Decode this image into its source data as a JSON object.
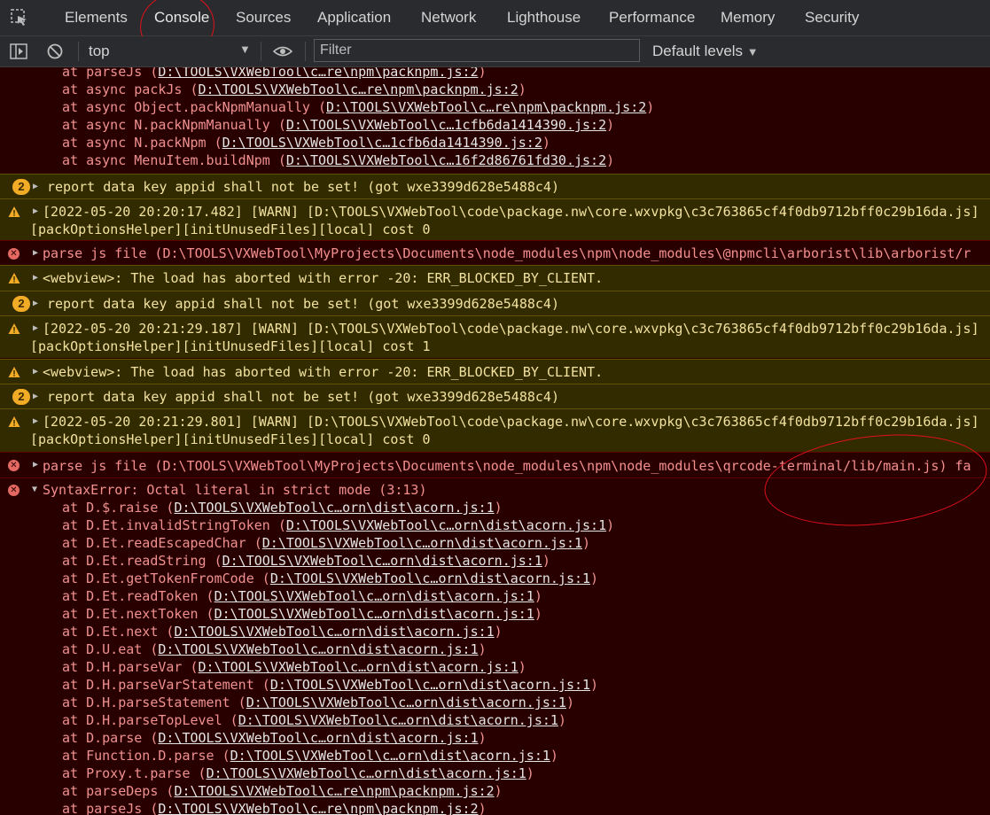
{
  "tabs": {
    "items": [
      "Elements",
      "Console",
      "Sources",
      "Application",
      "Network",
      "Lighthouse",
      "Performance",
      "Memory",
      "Security"
    ],
    "active": "Console"
  },
  "toolbar": {
    "context": "top",
    "filter_placeholder": "Filter",
    "levels": "Default levels"
  },
  "stack_top": [
    {
      "fn": "at parseJs",
      "link": "D:\\TOOLS\\VXWebTool\\c…re\\npm\\packnpm.js:2"
    },
    {
      "fn": "at async packJs",
      "link": "D:\\TOOLS\\VXWebTool\\c…re\\npm\\packnpm.js:2"
    },
    {
      "fn": "at async Object.packNpmManually",
      "link": "D:\\TOOLS\\VXWebTool\\c…re\\npm\\packnpm.js:2"
    },
    {
      "fn": "at async N.packNpmManually",
      "link": "D:\\TOOLS\\VXWebTool\\c…1cfb6da1414390.js:2"
    },
    {
      "fn": "at async N.packNpm",
      "link": "D:\\TOOLS\\VXWebTool\\c…1cfb6da1414390.js:2"
    },
    {
      "fn": "at async MenuItem.buildNpm",
      "link": "D:\\TOOLS\\VXWebTool\\c…16f2d86761fd30.js:2"
    }
  ],
  "messages": [
    {
      "level": "warn",
      "count": "2",
      "text": [
        "report data key appid shall not be set! (got wxe3399d628e5488c4)"
      ]
    },
    {
      "level": "warn",
      "text": [
        "[2022-05-20 20:20:17.482] [WARN] [D:\\TOOLS\\VXWebTool\\code\\package.nw\\core.wxvpkg\\c3c763865cf4f0db9712bff0c29b16da.js]",
        "[packOptionsHelper][initUnusedFiles][local] cost 0"
      ]
    },
    {
      "level": "error",
      "text": [
        "parse js file (D:\\TOOLS\\VXWebTool\\MyProjects\\Documents\\node_modules\\npm\\node_modules\\@npmcli\\arborist\\lib\\arborist/r"
      ]
    },
    {
      "level": "warn",
      "text": [
        "<webview>: The load has aborted with error -20: ERR_BLOCKED_BY_CLIENT."
      ]
    },
    {
      "level": "warn",
      "count": "2",
      "text": [
        "report data key appid shall not be set! (got wxe3399d628e5488c4)"
      ]
    },
    {
      "level": "warn",
      "text": [
        "[2022-05-20 20:21:29.187] [WARN] [D:\\TOOLS\\VXWebTool\\code\\package.nw\\core.wxvpkg\\c3c763865cf4f0db9712bff0c29b16da.js]",
        "[packOptionsHelper][initUnusedFiles][local] cost 1"
      ]
    },
    {
      "level": "warn",
      "text": [
        "<webview>: The load has aborted with error -20: ERR_BLOCKED_BY_CLIENT."
      ]
    },
    {
      "level": "warn",
      "count": "2",
      "text": [
        "report data key appid shall not be set! (got wxe3399d628e5488c4)"
      ]
    },
    {
      "level": "warn",
      "text": [
        "[2022-05-20 20:21:29.801] [WARN] [D:\\TOOLS\\VXWebTool\\code\\package.nw\\core.wxvpkg\\c3c763865cf4f0db9712bff0c29b16da.js]",
        "[packOptionsHelper][initUnusedFiles][local] cost 0"
      ]
    },
    {
      "level": "error",
      "text": [
        "parse js file (D:\\TOOLS\\VXWebTool\\MyProjects\\Documents\\node_modules\\npm\\node_modules\\qrcode-terminal/lib/main.js) fa"
      ]
    }
  ],
  "syntax_error": {
    "title": "SyntaxError: Octal literal in strict mode (3:13)",
    "stack": [
      {
        "fn": "at D.$.raise",
        "link": "D:\\TOOLS\\VXWebTool\\c…orn\\dist\\acorn.js:1"
      },
      {
        "fn": "at D.Et.invalidStringToken",
        "link": "D:\\TOOLS\\VXWebTool\\c…orn\\dist\\acorn.js:1"
      },
      {
        "fn": "at D.Et.readEscapedChar",
        "link": "D:\\TOOLS\\VXWebTool\\c…orn\\dist\\acorn.js:1"
      },
      {
        "fn": "at D.Et.readString",
        "link": "D:\\TOOLS\\VXWebTool\\c…orn\\dist\\acorn.js:1"
      },
      {
        "fn": "at D.Et.getTokenFromCode",
        "link": "D:\\TOOLS\\VXWebTool\\c…orn\\dist\\acorn.js:1"
      },
      {
        "fn": "at D.Et.readToken",
        "link": "D:\\TOOLS\\VXWebTool\\c…orn\\dist\\acorn.js:1"
      },
      {
        "fn": "at D.Et.nextToken",
        "link": "D:\\TOOLS\\VXWebTool\\c…orn\\dist\\acorn.js:1"
      },
      {
        "fn": "at D.Et.next",
        "link": "D:\\TOOLS\\VXWebTool\\c…orn\\dist\\acorn.js:1"
      },
      {
        "fn": "at D.U.eat",
        "link": "D:\\TOOLS\\VXWebTool\\c…orn\\dist\\acorn.js:1"
      },
      {
        "fn": "at D.H.parseVar",
        "link": "D:\\TOOLS\\VXWebTool\\c…orn\\dist\\acorn.js:1"
      },
      {
        "fn": "at D.H.parseVarStatement",
        "link": "D:\\TOOLS\\VXWebTool\\c…orn\\dist\\acorn.js:1"
      },
      {
        "fn": "at D.H.parseStatement",
        "link": "D:\\TOOLS\\VXWebTool\\c…orn\\dist\\acorn.js:1"
      },
      {
        "fn": "at D.H.parseTopLevel",
        "link": "D:\\TOOLS\\VXWebTool\\c…orn\\dist\\acorn.js:1"
      },
      {
        "fn": "at D.parse",
        "link": "D:\\TOOLS\\VXWebTool\\c…orn\\dist\\acorn.js:1"
      },
      {
        "fn": "at Function.D.parse",
        "link": "D:\\TOOLS\\VXWebTool\\c…orn\\dist\\acorn.js:1"
      },
      {
        "fn": "at Proxy.t.parse",
        "link": "D:\\TOOLS\\VXWebTool\\c…orn\\dist\\acorn.js:1"
      },
      {
        "fn": "at parseDeps",
        "link": "D:\\TOOLS\\VXWebTool\\c…re\\npm\\packnpm.js:2"
      },
      {
        "fn": "at parseJs",
        "link": "D:\\TOOLS\\VXWebTool\\c…re\\npm\\packnpm.js:2"
      }
    ]
  },
  "colors": {
    "error_bg": "#290000",
    "warn_bg": "#332b00",
    "error_text": "#f48f8f",
    "warn_text": "#f2e2a0",
    "annotation": "#e0101a"
  }
}
